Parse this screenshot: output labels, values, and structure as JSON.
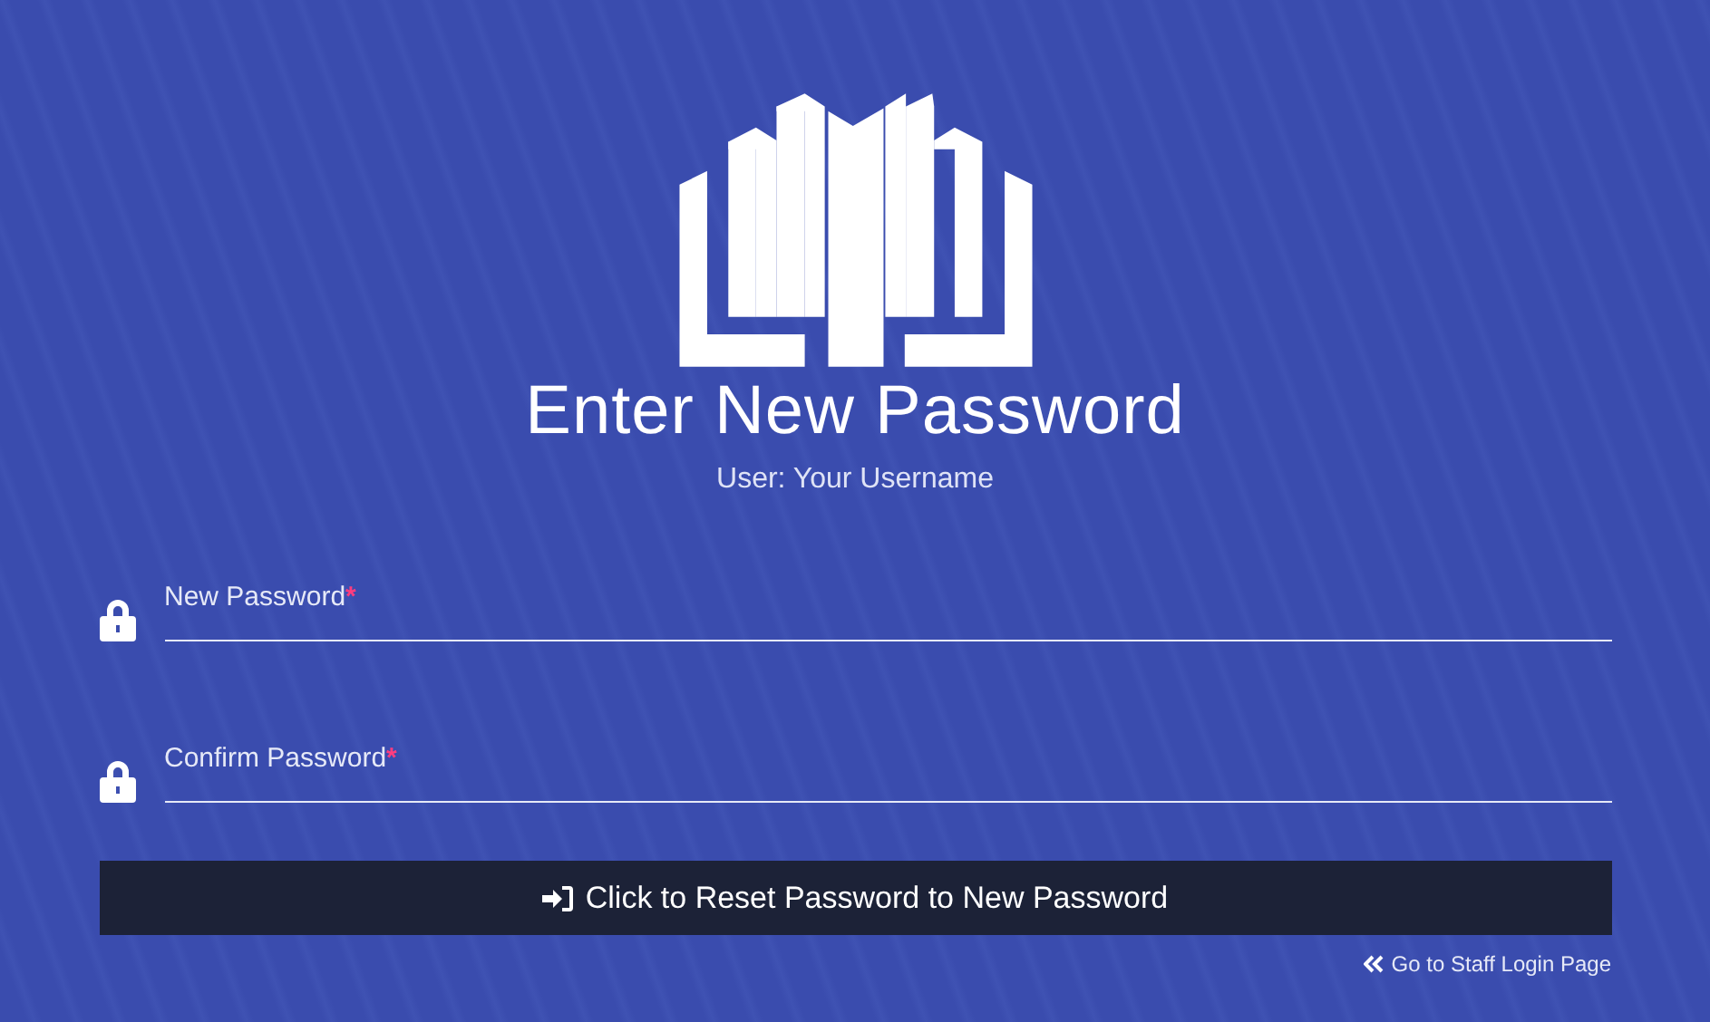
{
  "title": "Enter New Password",
  "user_line": "User: Your Username",
  "fields": [
    {
      "label": "New Password",
      "required_mark": "*"
    },
    {
      "label": "Confirm Password",
      "required_mark": "*"
    }
  ],
  "submit_button": "Click to Reset Password to New Password",
  "back_link": "Go to Staff Login Page"
}
